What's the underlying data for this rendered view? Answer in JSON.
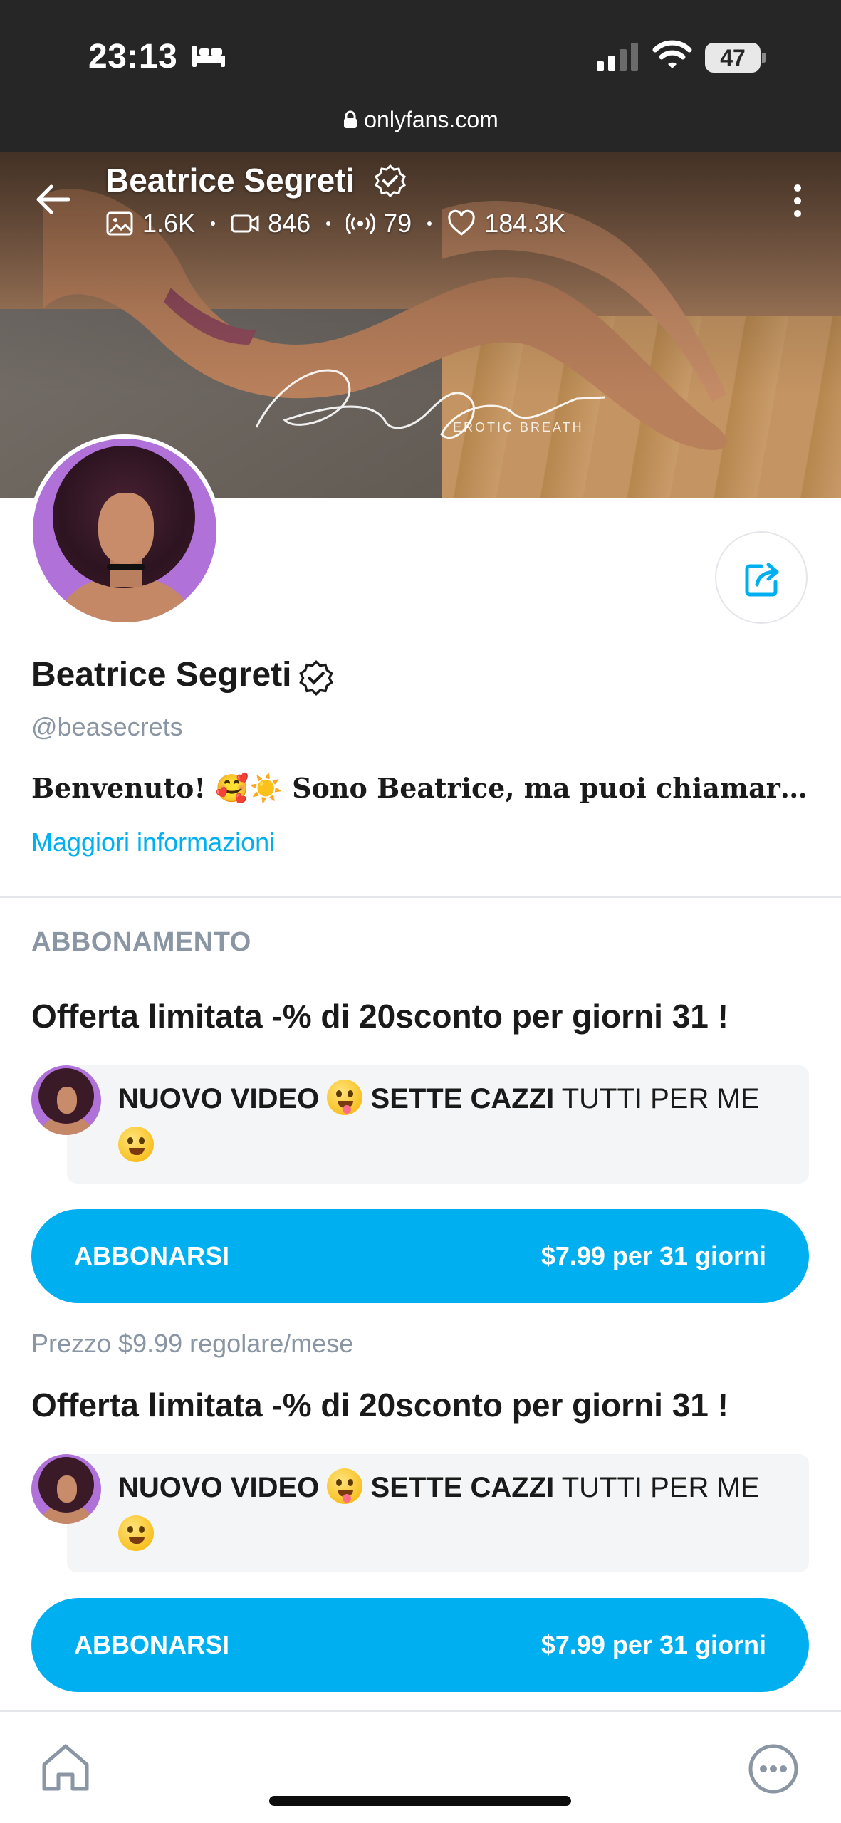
{
  "status_bar": {
    "time": "23:13",
    "battery": "47",
    "url": "onlyfans.com",
    "icons": [
      "bed-icon",
      "signal-icon",
      "wifi-icon",
      "lock-icon"
    ]
  },
  "cover": {
    "name": "Beatrice Segreti",
    "stats": {
      "photos": "1.6K",
      "videos": "846",
      "streams": "79",
      "likes": "184.3K"
    },
    "watermark": "Bea Secrets",
    "watermark_sub": "EROTIC BREATH"
  },
  "profile": {
    "name": "Beatrice Segreti",
    "handle": "@beasecrets",
    "bio": "Benvenuto! 🥰☀️ Sono Beatrice, ma puoi chiamarm...",
    "more_info": "Maggiori informazioni"
  },
  "subscription": {
    "section_title": "ABBONAMENTO",
    "offers": [
      {
        "title": "Offerta limitata -% di 20sconto per giorni 31 !",
        "message_bold1": "NUOVO VIDEO",
        "message_bold2": "SETTE CAZZI",
        "message_rest": "TUTTI PER ME",
        "button_label": "ABBONARSI",
        "button_price": "$7.99 per 31 giorni"
      },
      {
        "title": "Offerta limitata -% di 20sconto per giorni 31 !",
        "message_bold1": "NUOVO VIDEO",
        "message_bold2": "SETTE CAZZI",
        "message_rest": "TUTTI PER ME",
        "button_label": "ABBONARSI",
        "button_price": "$7.99 per 31 giorni"
      }
    ],
    "regular_price": "Prezzo $9.99 regolare/mese"
  },
  "colors": {
    "accent": "#00aff0",
    "muted": "#8a96a3",
    "status_bar_bg": "#262626"
  }
}
